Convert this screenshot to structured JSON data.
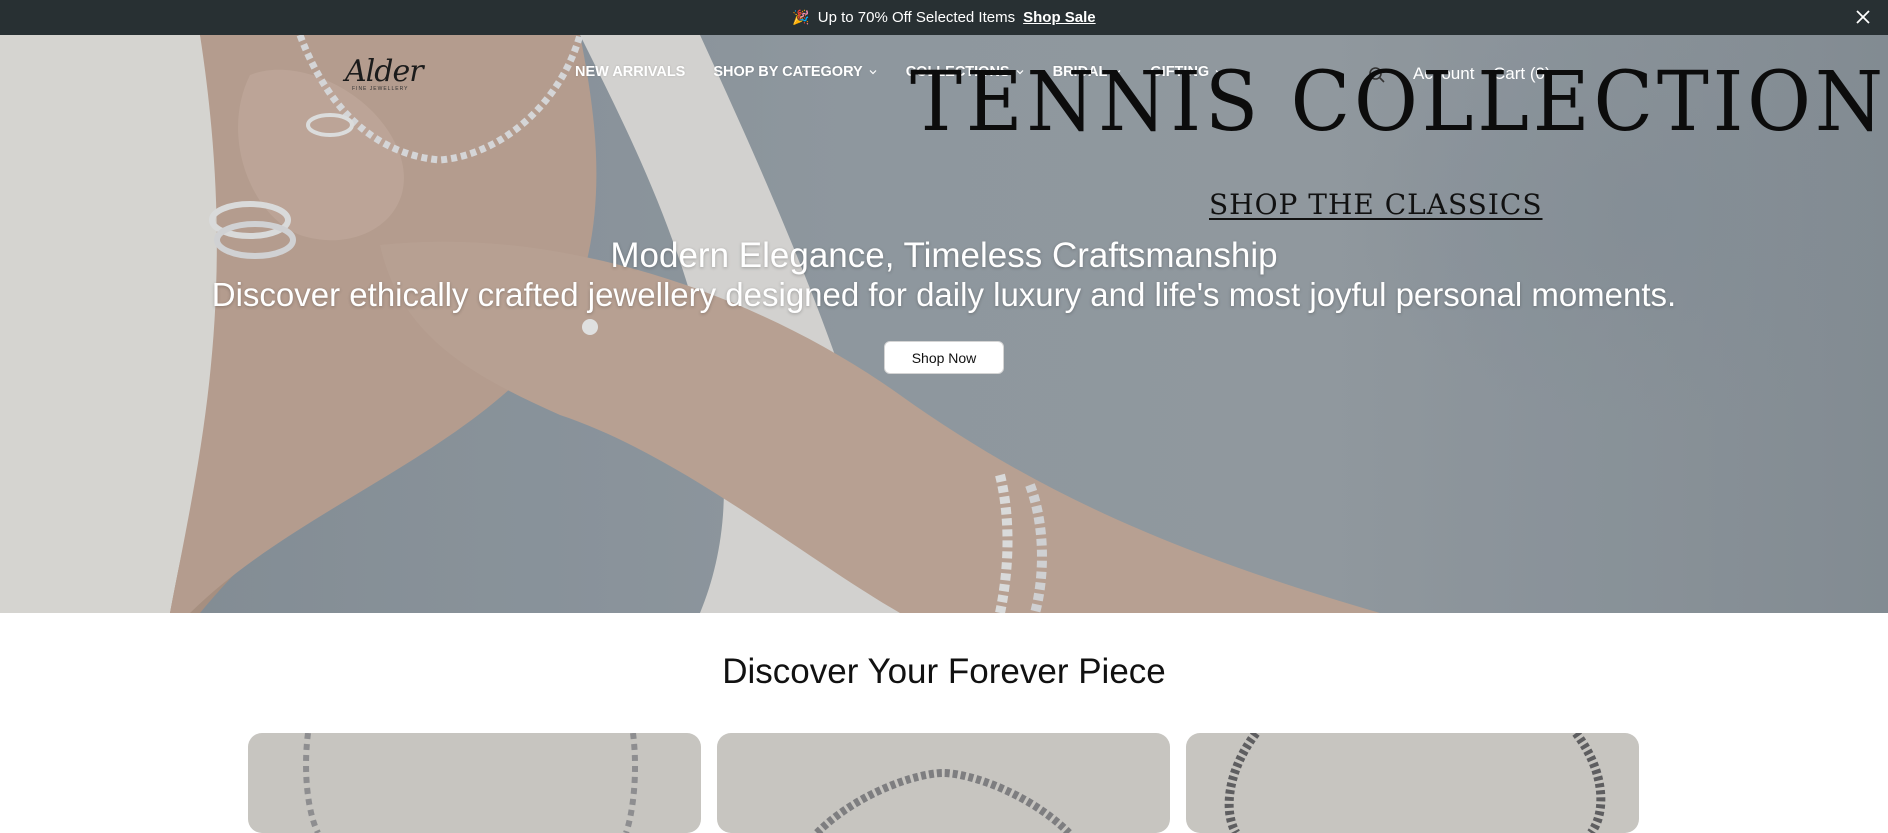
{
  "announcement": {
    "emoji": "🎉",
    "text": "Up to 70% Off Selected Items",
    "link": "Shop Sale"
  },
  "header": {
    "logo": "Alder",
    "logo_sub": "FINE JEWELLERY",
    "nav": [
      {
        "label": "NEW ARRIVALS",
        "dropdown": false
      },
      {
        "label": "SHOP BY CATEGORY",
        "dropdown": true
      },
      {
        "label": "COLLECTIONS",
        "dropdown": true
      },
      {
        "label": "BRIDAL",
        "dropdown": true
      },
      {
        "label": "GIFTING",
        "dropdown": true
      }
    ],
    "account": "Account",
    "cart": "Cart (0)"
  },
  "hero": {
    "title": "TENNIS COLLECTION",
    "cta_link": "SHOP THE CLASSICS",
    "headline": "Modern Elegance, Timeless Craftsmanship",
    "subheadline": "Discover ethically crafted jewellery designed for daily luxury and life's most joyful personal moments.",
    "button": "Shop Now"
  },
  "section": {
    "title": "Discover Your Forever Piece"
  },
  "colors": {
    "announcement_bg": "#283033",
    "card_bg": "#c7c5c0",
    "text_dark": "#111111"
  }
}
